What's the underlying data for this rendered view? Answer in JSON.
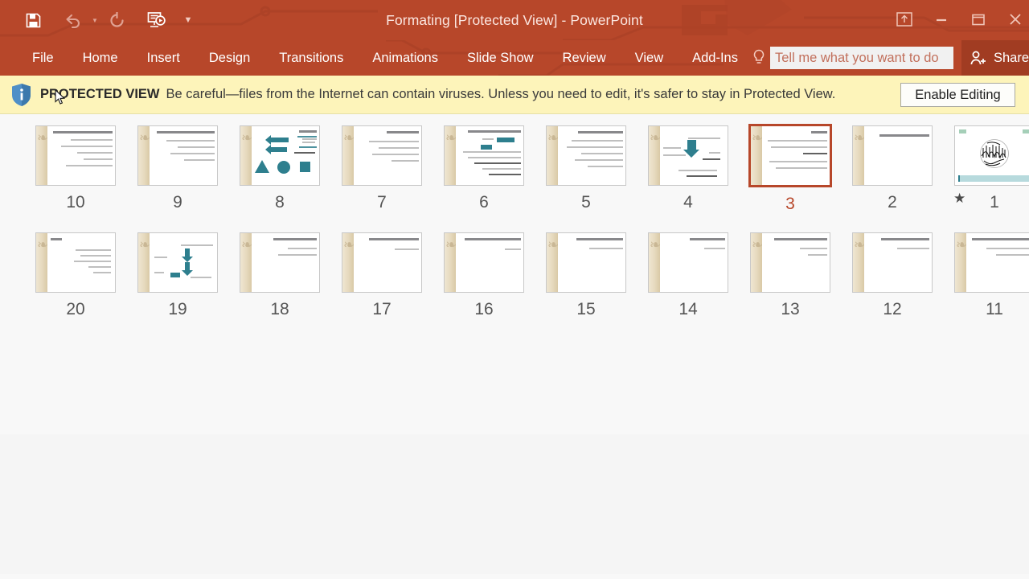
{
  "window": {
    "title": "Formating [Protected View] - PowerPoint",
    "quick_access": [
      {
        "name": "save-icon",
        "label": "Save",
        "enabled": true
      },
      {
        "name": "undo-icon",
        "label": "Undo",
        "enabled": false
      },
      {
        "name": "redo-icon",
        "label": "Redo",
        "enabled": false
      },
      {
        "name": "start-slideshow-icon",
        "label": "Start From Beginning",
        "enabled": true
      },
      {
        "name": "customize-qat-icon",
        "label": "Customize Quick Access Toolbar",
        "enabled": true
      }
    ],
    "controls": [
      {
        "name": "ribbon-display-options-icon",
        "label": "Ribbon Display Options"
      },
      {
        "name": "minimize-icon",
        "label": "Minimize"
      },
      {
        "name": "restore-icon",
        "label": "Restore Down"
      },
      {
        "name": "close-icon",
        "label": "Close"
      }
    ],
    "accent_color": "#b7472a"
  },
  "ribbon": {
    "tabs": [
      {
        "label": "File"
      },
      {
        "label": "Home"
      },
      {
        "label": "Insert"
      },
      {
        "label": "Design"
      },
      {
        "label": "Transitions"
      },
      {
        "label": "Animations"
      },
      {
        "label": "Slide Show"
      },
      {
        "label": "Review"
      },
      {
        "label": "View"
      },
      {
        "label": "Add-Ins"
      }
    ],
    "tellme": {
      "placeholder": "Tell me what you want to do",
      "value": ""
    },
    "share_label": "Share"
  },
  "protected_view": {
    "badge": "PROTECTED VIEW",
    "message": "Be careful—files from the Internet can contain viruses. Unless you need to edit, it's safer to stay in Protected View.",
    "enable_button": "Enable Editing",
    "bar_color": "#fdf4ba"
  },
  "slide_sorter": {
    "selected_slide": 3,
    "rows": [
      {
        "slides": [
          {
            "number": "10",
            "kind": "bullets"
          },
          {
            "number": "9",
            "kind": "bullets"
          },
          {
            "number": "8",
            "kind": "shapes"
          },
          {
            "number": "7",
            "kind": "bullets"
          },
          {
            "number": "6",
            "kind": "bullets-accent"
          },
          {
            "number": "5",
            "kind": "bullets"
          },
          {
            "number": "4",
            "kind": "arrow-down"
          },
          {
            "number": "3",
            "kind": "bullets",
            "selected": true
          },
          {
            "number": "2",
            "kind": "title-only"
          },
          {
            "number": "1",
            "kind": "title-art",
            "animated": true
          }
        ]
      },
      {
        "slides": [
          {
            "number": "20",
            "kind": "bullets-right"
          },
          {
            "number": "19",
            "kind": "flow"
          },
          {
            "number": "18",
            "kind": "bullets"
          },
          {
            "number": "17",
            "kind": "bullets"
          },
          {
            "number": "16",
            "kind": "bullets"
          },
          {
            "number": "15",
            "kind": "bullets"
          },
          {
            "number": "14",
            "kind": "bullets"
          },
          {
            "number": "13",
            "kind": "bullets"
          },
          {
            "number": "12",
            "kind": "bullets"
          },
          {
            "number": "11",
            "kind": "bullets"
          }
        ]
      }
    ],
    "animation_marker": "★",
    "selected_number_color": "#b7472a"
  }
}
